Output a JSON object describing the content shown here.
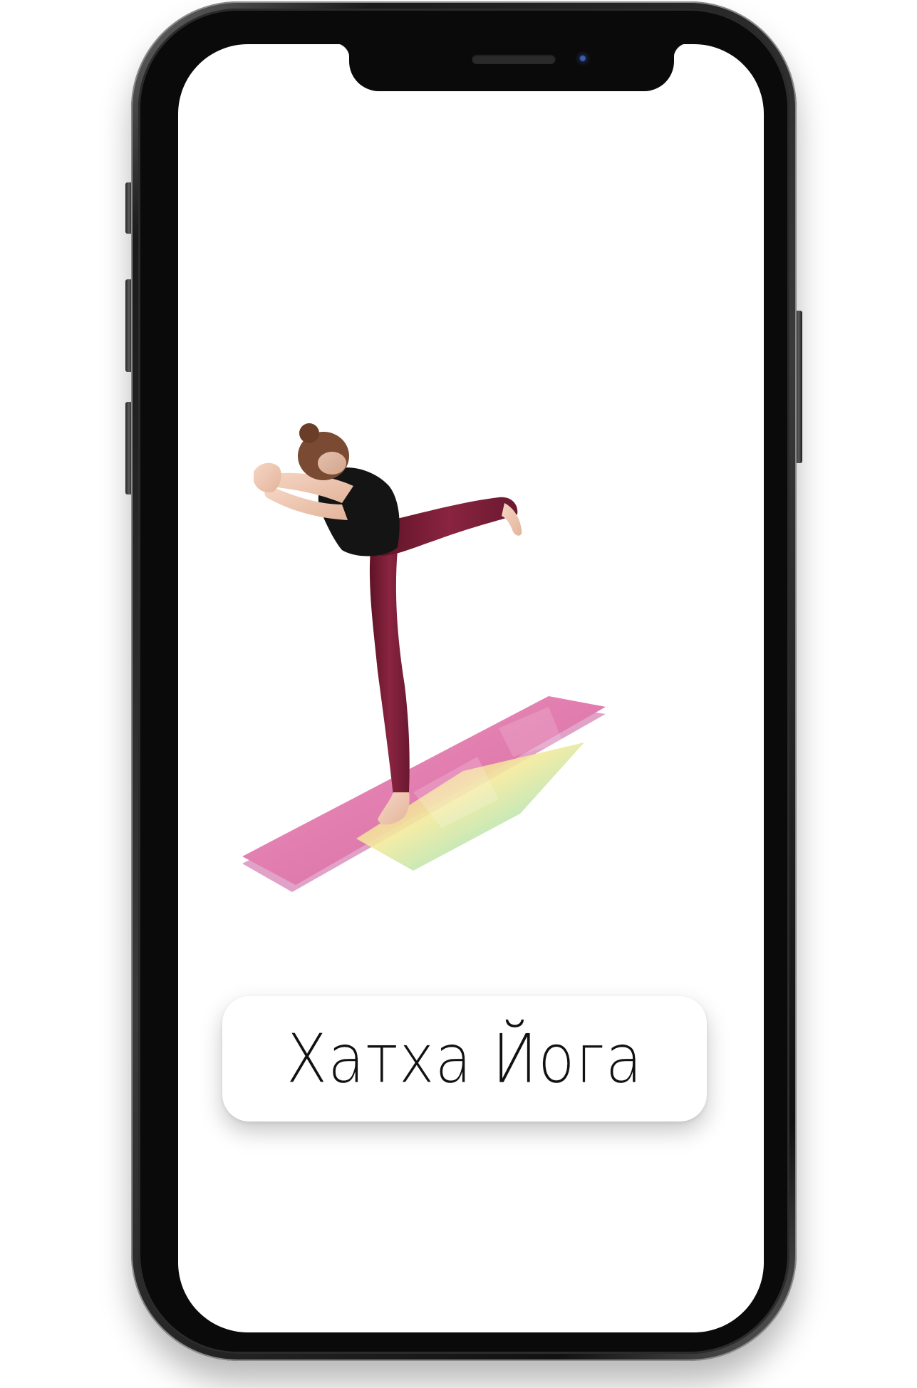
{
  "app": {
    "label_card": {
      "text": "Хатха Йога"
    },
    "hero_image": {
      "subject": "woman-in-warrior-three-pose-on-yoga-mat"
    },
    "icons": {
      "camera": "camera-icon",
      "speaker": "speaker-grille-icon"
    },
    "colors": {
      "background": "#ffffff",
      "phone_frame": "#1a1a1a",
      "leggings": "#7c1d33",
      "top": "#151515",
      "mat_pink": "#e88bb3",
      "label_text": "#111111"
    }
  }
}
